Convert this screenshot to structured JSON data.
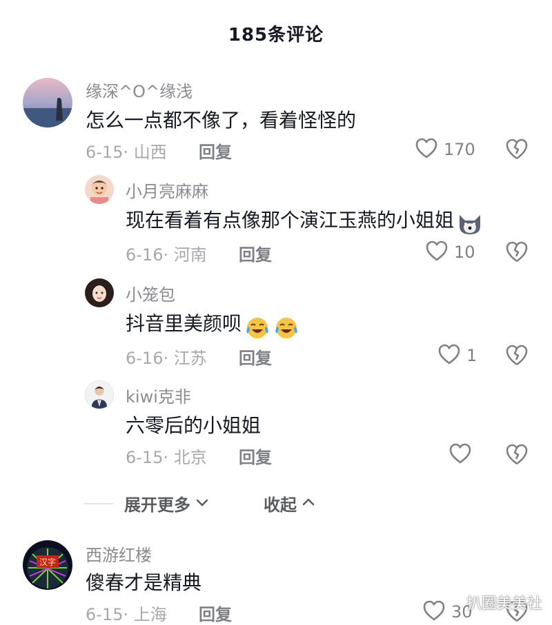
{
  "header": {
    "title": "185条评论"
  },
  "comments": [
    {
      "user": "缘深^O^缘浅",
      "text": "怎么一点都不像了，看着怪怪的",
      "date_loc": "6-15· 山西",
      "reply": "回复",
      "likes": "170"
    },
    {
      "user": "小月亮麻麻",
      "text": "现在看着有点像那个演江玉燕的小姐姐",
      "date_loc": "6-16· 河南",
      "reply": "回复",
      "likes": "10",
      "emoji": "dog-face-emoji"
    },
    {
      "user": "小笼包",
      "text": "抖音里美颜呗",
      "date_loc": "6-16· 江苏",
      "reply": "回复",
      "likes": "1",
      "emoji": "crying-laughing-emoji"
    },
    {
      "user": "kiwi克非",
      "text": "六零后的小姐姐",
      "date_loc": "6-15· 北京",
      "reply": "回复",
      "likes": ""
    },
    {
      "user": "西游红楼",
      "text": "傻春才是精典",
      "date_loc": "6-15· 上海",
      "reply": "回复",
      "likes": "30",
      "avatar_text": "汉字"
    }
  ],
  "thread_controls": {
    "expand_more": "展开更多",
    "collapse": "收起"
  },
  "watermark": "扒圈美美社",
  "colors": {
    "text": "#161823",
    "muted": "#a7a8ad",
    "username": "#8a8b91"
  }
}
